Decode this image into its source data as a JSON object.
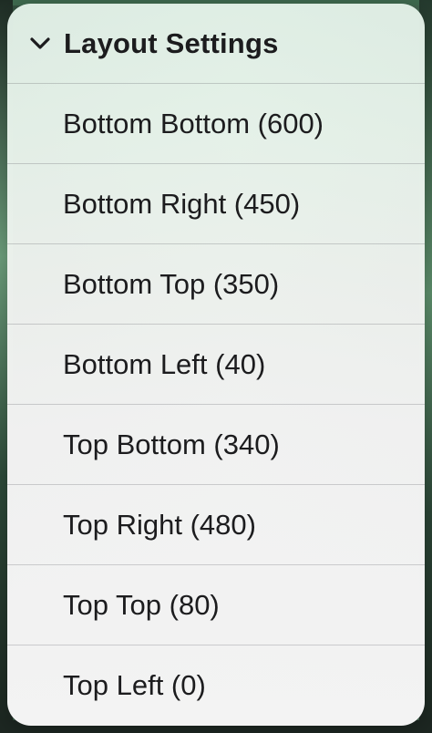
{
  "menu": {
    "title": "Layout Settings",
    "items": [
      {
        "label": "Bottom Bottom (600)"
      },
      {
        "label": "Bottom Right (450)"
      },
      {
        "label": "Bottom Top (350)"
      },
      {
        "label": "Bottom Left (40)"
      },
      {
        "label": "Top Bottom (340)"
      },
      {
        "label": "Top Right (480)"
      },
      {
        "label": "Top Top (80)"
      },
      {
        "label": "Top Left (0)"
      }
    ]
  },
  "icons": {
    "header_icon": "chevron-down-icon"
  }
}
